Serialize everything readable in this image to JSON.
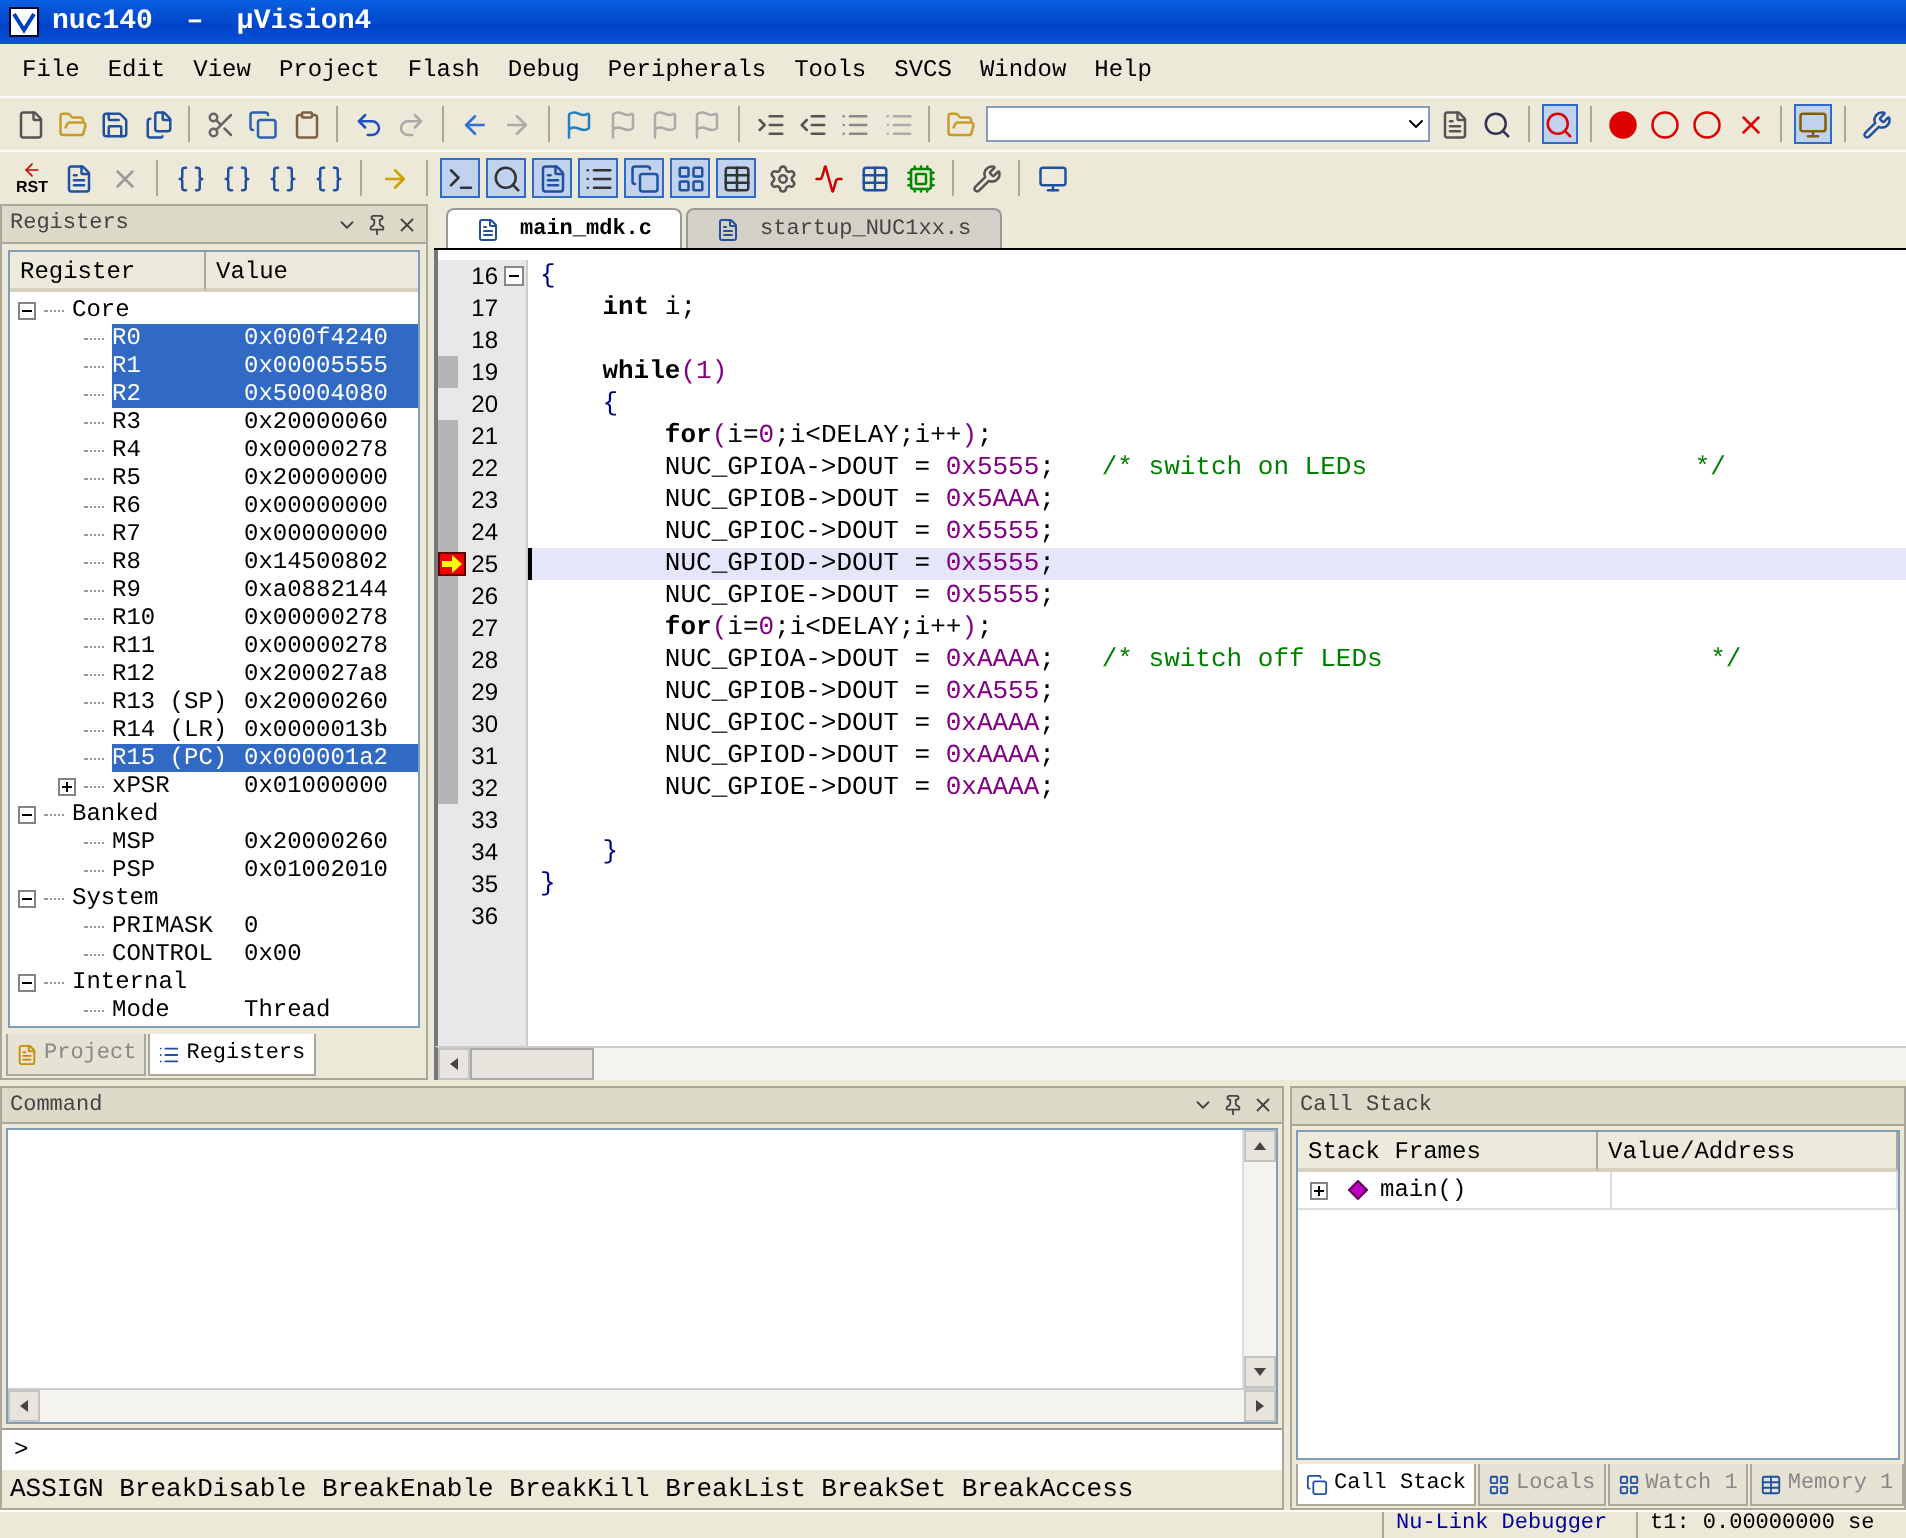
{
  "window": {
    "title": "nuc140  –  µVision4"
  },
  "menu": [
    "File",
    "Edit",
    "View",
    "Project",
    "Flash",
    "Debug",
    "Peripherals",
    "Tools",
    "SVCS",
    "Window",
    "Help"
  ],
  "toolbar": {
    "reset_label": "RST"
  },
  "registers_panel": {
    "title": "Registers",
    "columns": [
      "Register",
      "Value"
    ],
    "tree": [
      {
        "name": "Core",
        "expanded": true,
        "children": [
          {
            "name": "R0",
            "value": "0x000f4240",
            "selected": true
          },
          {
            "name": "R1",
            "value": "0x00005555",
            "selected": true
          },
          {
            "name": "R2",
            "value": "0x50004080",
            "selected": true
          },
          {
            "name": "R3",
            "value": "0x20000060",
            "selected": false
          },
          {
            "name": "R4",
            "value": "0x00000278",
            "selected": false
          },
          {
            "name": "R5",
            "value": "0x20000000",
            "selected": false
          },
          {
            "name": "R6",
            "value": "0x00000000",
            "selected": false
          },
          {
            "name": "R7",
            "value": "0x00000000",
            "selected": false
          },
          {
            "name": "R8",
            "value": "0x14500802",
            "selected": false
          },
          {
            "name": "R9",
            "value": "0xa0882144",
            "selected": false
          },
          {
            "name": "R10",
            "value": "0x00000278",
            "selected": false
          },
          {
            "name": "R11",
            "value": "0x00000278",
            "selected": false
          },
          {
            "name": "R12",
            "value": "0x200027a8",
            "selected": false
          },
          {
            "name": "R13 (SP)",
            "value": "0x20000260",
            "selected": false
          },
          {
            "name": "R14 (LR)",
            "value": "0x0000013b",
            "selected": false
          },
          {
            "name": "R15 (PC)",
            "value": "0x000001a2",
            "selected": true
          },
          {
            "name": "xPSR",
            "value": "0x01000000",
            "selected": false,
            "expanded": false
          }
        ]
      },
      {
        "name": "Banked",
        "expanded": true,
        "children": [
          {
            "name": "MSP",
            "value": "0x20000260",
            "selected": false
          },
          {
            "name": "PSP",
            "value": "0x01002010",
            "selected": false
          }
        ]
      },
      {
        "name": "System",
        "expanded": true,
        "children": [
          {
            "name": "PRIMASK",
            "value": "0",
            "selected": false
          },
          {
            "name": "CONTROL",
            "value": "0x00",
            "selected": false
          }
        ]
      },
      {
        "name": "Internal",
        "expanded": true,
        "children": [
          {
            "name": "Mode",
            "value": "Thread",
            "selected": false
          }
        ]
      }
    ],
    "tabs": [
      {
        "label": "Project",
        "selected": false
      },
      {
        "label": "Registers",
        "selected": true
      }
    ]
  },
  "editor": {
    "tabs": [
      {
        "label": "main_mdk.c",
        "selected": true
      },
      {
        "label": "startup_NUC1xx.s",
        "selected": false
      }
    ],
    "lines": [
      {
        "number": "16",
        "executable": false,
        "current": false,
        "tokens": [
          {
            "kind": "brace",
            "text": "{"
          }
        ]
      },
      {
        "number": "17",
        "executable": false,
        "current": false,
        "tokens": [
          {
            "kind": "keyword",
            "text": "    int"
          },
          {
            "kind": "text",
            "text": " i;"
          }
        ]
      },
      {
        "number": "18",
        "executable": false,
        "current": false
      },
      {
        "number": "19",
        "executable": true,
        "current": false,
        "tokens": [
          {
            "kind": "keyword",
            "text": "    while"
          },
          {
            "kind": "number",
            "text": "(1)"
          }
        ]
      },
      {
        "number": "20",
        "executable": false,
        "current": false,
        "tokens": [
          {
            "kind": "brace",
            "text": "    {"
          }
        ]
      },
      {
        "number": "21",
        "executable": true,
        "current": false,
        "tokens": [
          {
            "kind": "keyword",
            "text": "        for"
          },
          {
            "kind": "number",
            "text": "("
          },
          {
            "kind": "text",
            "text": "i="
          },
          {
            "kind": "number",
            "text": "0"
          },
          {
            "kind": "text",
            "text": ";i<DELAY;i++"
          },
          {
            "kind": "number",
            "text": ")"
          },
          {
            "kind": "text",
            "text": ";"
          }
        ]
      },
      {
        "number": "22",
        "executable": true,
        "current": false,
        "tokens": [
          {
            "kind": "text",
            "text": "        NUC_GPIOA->DOUT = "
          },
          {
            "kind": "number",
            "text": "0x5555"
          },
          {
            "kind": "text",
            "text": ";   "
          },
          {
            "kind": "comment",
            "text": "/* switch on LEDs                     */"
          }
        ]
      },
      {
        "number": "23",
        "executable": true,
        "current": false,
        "tokens": [
          {
            "kind": "text",
            "text": "        NUC_GPIOB->DOUT = "
          },
          {
            "kind": "number",
            "text": "0x5AAA"
          },
          {
            "kind": "text",
            "text": ";"
          }
        ]
      },
      {
        "number": "24",
        "executable": true,
        "current": false,
        "tokens": [
          {
            "kind": "text",
            "text": "        NUC_GPIOC->DOUT = "
          },
          {
            "kind": "number",
            "text": "0x5555"
          },
          {
            "kind": "text",
            "text": ";"
          }
        ]
      },
      {
        "number": "25",
        "executable": true,
        "current": true,
        "tokens": [
          {
            "kind": "text",
            "text": "        NUC_GPIOD->DOUT = "
          },
          {
            "kind": "number",
            "text": "0x5555"
          },
          {
            "kind": "text",
            "text": ";"
          }
        ]
      },
      {
        "number": "26",
        "executable": true,
        "current": false,
        "tokens": [
          {
            "kind": "text",
            "text": "        NUC_GPIOE->DOUT = "
          },
          {
            "kind": "number",
            "text": "0x5555"
          },
          {
            "kind": "text",
            "text": ";"
          }
        ]
      },
      {
        "number": "27",
        "executable": true,
        "current": false,
        "tokens": [
          {
            "kind": "keyword",
            "text": "        for"
          },
          {
            "kind": "number",
            "text": "("
          },
          {
            "kind": "text",
            "text": "i="
          },
          {
            "kind": "number",
            "text": "0"
          },
          {
            "kind": "text",
            "text": ";i<DELAY;i++"
          },
          {
            "kind": "number",
            "text": ")"
          },
          {
            "kind": "text",
            "text": ";"
          }
        ]
      },
      {
        "number": "28",
        "executable": true,
        "current": false,
        "tokens": [
          {
            "kind": "text",
            "text": "        NUC_GPIOA->DOUT = "
          },
          {
            "kind": "number",
            "text": "0xAAAA"
          },
          {
            "kind": "text",
            "text": ";   "
          },
          {
            "kind": "comment",
            "text": "/* switch off LEDs                     */"
          }
        ]
      },
      {
        "number": "29",
        "executable": true,
        "current": false,
        "tokens": [
          {
            "kind": "text",
            "text": "        NUC_GPIOB->DOUT = "
          },
          {
            "kind": "number",
            "text": "0xA555"
          },
          {
            "kind": "text",
            "text": ";"
          }
        ]
      },
      {
        "number": "30",
        "executable": true,
        "current": false,
        "tokens": [
          {
            "kind": "text",
            "text": "        NUC_GPIOC->DOUT = "
          },
          {
            "kind": "number",
            "text": "0xAAAA"
          },
          {
            "kind": "text",
            "text": ";"
          }
        ]
      },
      {
        "number": "31",
        "executable": true,
        "current": false,
        "tokens": [
          {
            "kind": "text",
            "text": "        NUC_GPIOD->DOUT = "
          },
          {
            "kind": "number",
            "text": "0xAAAA"
          },
          {
            "kind": "text",
            "text": ";"
          }
        ]
      },
      {
        "number": "32",
        "executable": true,
        "current": false,
        "tokens": [
          {
            "kind": "text",
            "text": "        NUC_GPIOE->DOUT = "
          },
          {
            "kind": "number",
            "text": "0xAAAA"
          },
          {
            "kind": "text",
            "text": ";"
          }
        ]
      },
      {
        "number": "33",
        "executable": false,
        "current": false
      },
      {
        "number": "34",
        "executable": false,
        "current": false,
        "tokens": [
          {
            "kind": "brace",
            "text": "    }"
          }
        ]
      },
      {
        "number": "35",
        "executable": false,
        "current": false,
        "tokens": [
          {
            "kind": "brace",
            "text": "}"
          }
        ]
      },
      {
        "number": "36",
        "executable": false,
        "current": false
      }
    ]
  },
  "command_panel": {
    "title": "Command",
    "prompt": ">",
    "hint": "ASSIGN BreakDisable BreakEnable BreakKill BreakList BreakSet BreakAccess"
  },
  "call_stack_panel": {
    "title": "Call Stack",
    "columns": [
      "Stack Frames",
      "Value/Address"
    ],
    "rows": [
      {
        "frame": "main()",
        "expanded": false
      }
    ],
    "tabs": [
      {
        "label": "Call Stack",
        "selected": true
      },
      {
        "label": "Locals",
        "selected": false
      },
      {
        "label": "Watch 1",
        "selected": false
      },
      {
        "label": "Memory 1",
        "selected": false
      }
    ]
  },
  "status_bar": {
    "debugger": "Nu-Link Debugger",
    "time": "t1: 0.00000000 se"
  }
}
